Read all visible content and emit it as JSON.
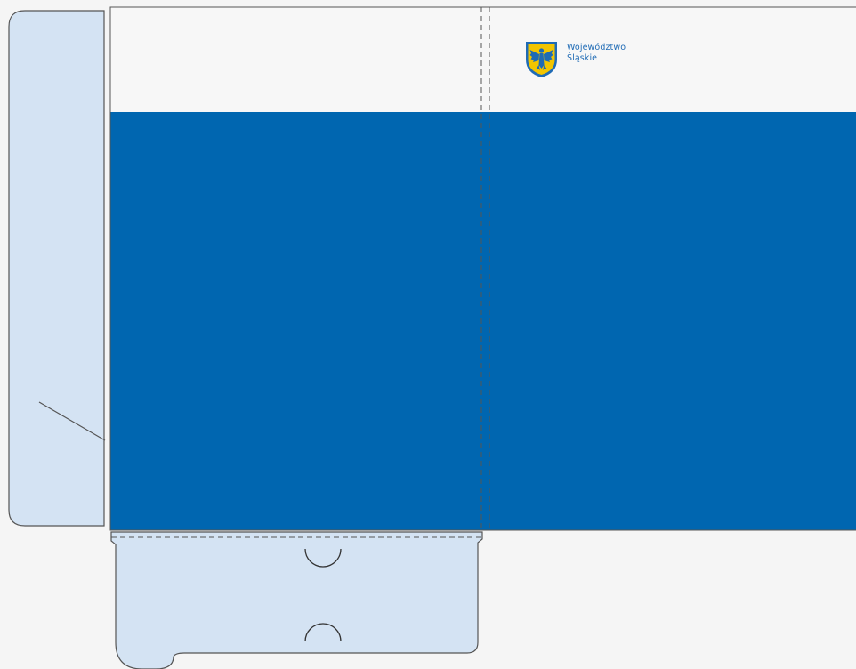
{
  "brand": {
    "line1": "Województwo",
    "line2": "Śląskie",
    "crest_icon": "silesian-eagle-crest-icon"
  },
  "colors": {
    "background": "#f5f5f5",
    "cover_white": "#f7f7f7",
    "cover_blue": "#0066b0",
    "flap_fill": "#d4e3f3",
    "outline": "#555555",
    "crest_blue": "#1f6bb5",
    "crest_gold": "#f2c500",
    "brand_text": "#1f6bb5"
  }
}
